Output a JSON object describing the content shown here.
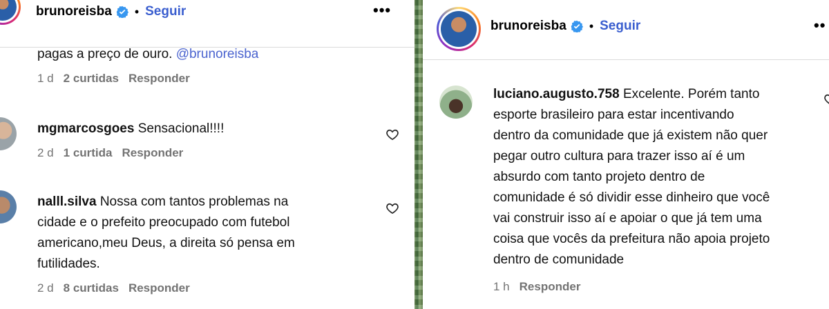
{
  "left": {
    "header": {
      "username": "brunoreisba",
      "separator": "•",
      "follow": "Seguir",
      "more": "•••"
    },
    "partial_comment": {
      "text": "pagas a preço de ouro.",
      "mention": "@brunoreisba",
      "time": "1 d",
      "likes": "2 curtidas",
      "reply": "Responder"
    },
    "comments": [
      {
        "user": "mgmarcosgoes",
        "text": "Sensacional!!!!",
        "time": "2 d",
        "likes": "1 curtida",
        "reply": "Responder"
      },
      {
        "user": "nalll.silva",
        "lines": [
          "Nossa com tantos problemas na",
          "cidade e o prefeito preocupado com futebol",
          "americano,meu Deus, a direita só pensa em",
          "futilidades."
        ],
        "time": "2 d",
        "likes": "8 curtidas",
        "reply": "Responder"
      }
    ]
  },
  "right": {
    "header": {
      "username": "brunoreisba",
      "separator": "•",
      "follow": "Seguir",
      "more": "••"
    },
    "comment": {
      "user": "luciano.augusto.758",
      "lines": [
        "Excelente. Porém tanto",
        "esporte brasileiro para estar incentivando",
        "dentro da comunidade que já existem não quer",
        "pegar outro cultura para trazer isso aí é um",
        "absurdo com tanto projeto dentro de",
        "comunidade é só dividir esse dinheiro que você",
        "vai construir isso aí e apoiar o que já tem uma",
        "coisa que vocês da prefeitura não apoia projeto",
        "dentro de comunidade"
      ],
      "time": "1 h",
      "reply": "Responder"
    }
  },
  "icons": {
    "verified": "verified-badge-icon",
    "heart": "heart-outline-icon",
    "more": "more-options-icon"
  },
  "colors": {
    "follow": "#3a5ecf",
    "verified": "#3897f0",
    "meta": "#737373"
  }
}
